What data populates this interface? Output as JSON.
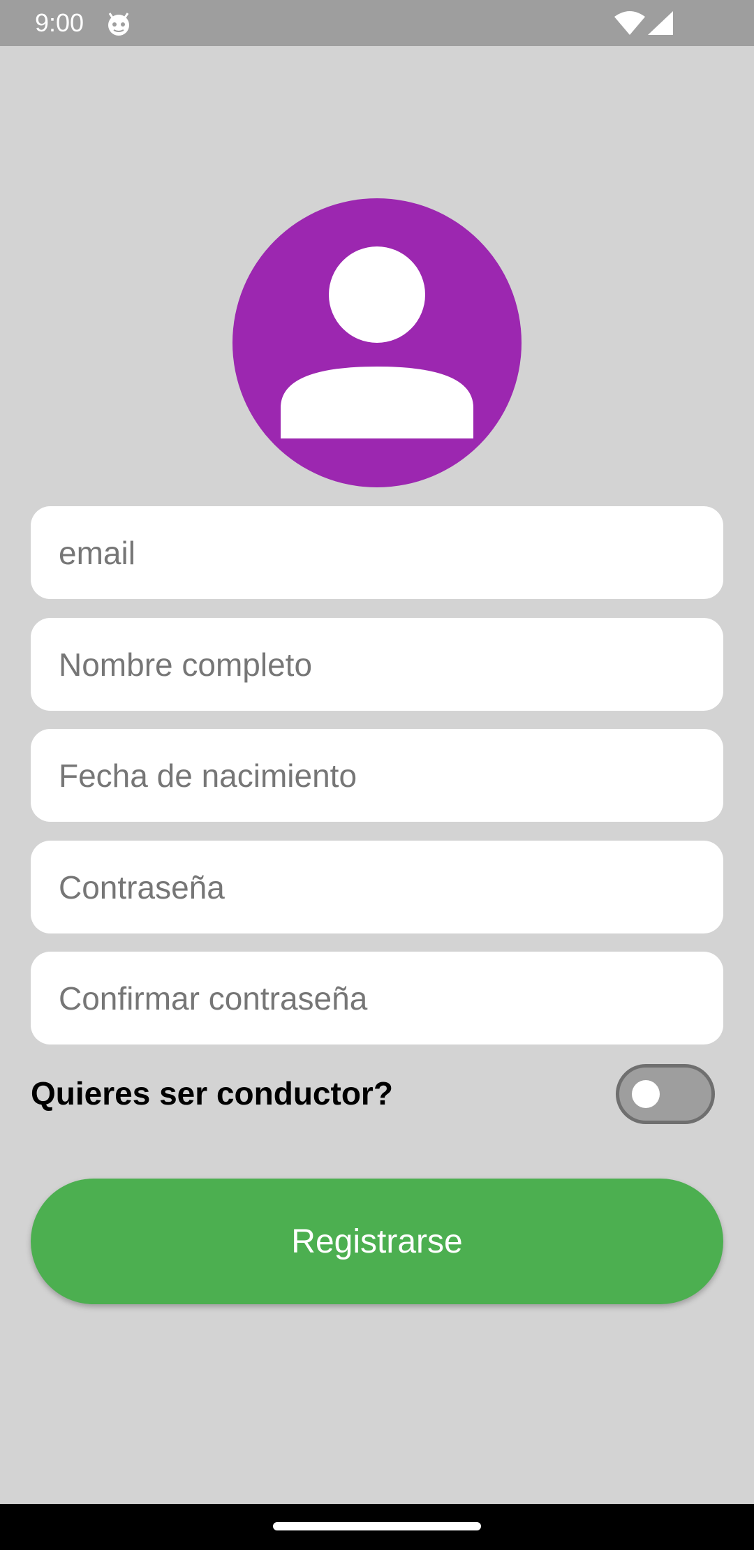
{
  "status_bar": {
    "time": "9:00",
    "app_icon": "android-app-icon",
    "wifi_icon": "wifi-icon",
    "signal_icon": "cellular-signal-icon"
  },
  "avatar": {
    "icon": "person-icon",
    "background_color": "#9c27b0"
  },
  "form": {
    "email_placeholder": "email",
    "name_placeholder": "Nombre completo",
    "birthdate_placeholder": "Fecha de nacimiento",
    "password_placeholder": "Contraseña",
    "confirm_password_placeholder": "Confirmar contraseña",
    "email_value": "",
    "name_value": "",
    "birthdate_value": "",
    "password_value": "",
    "confirm_password_value": ""
  },
  "driver": {
    "label": "Quieres ser conductor?",
    "toggle_on": false
  },
  "register_button": {
    "label": "Registrarse",
    "color": "#4caf50"
  },
  "colors": {
    "background": "#d3d3d3",
    "status_bar": "#9e9e9e",
    "nav_bar": "#000000"
  }
}
